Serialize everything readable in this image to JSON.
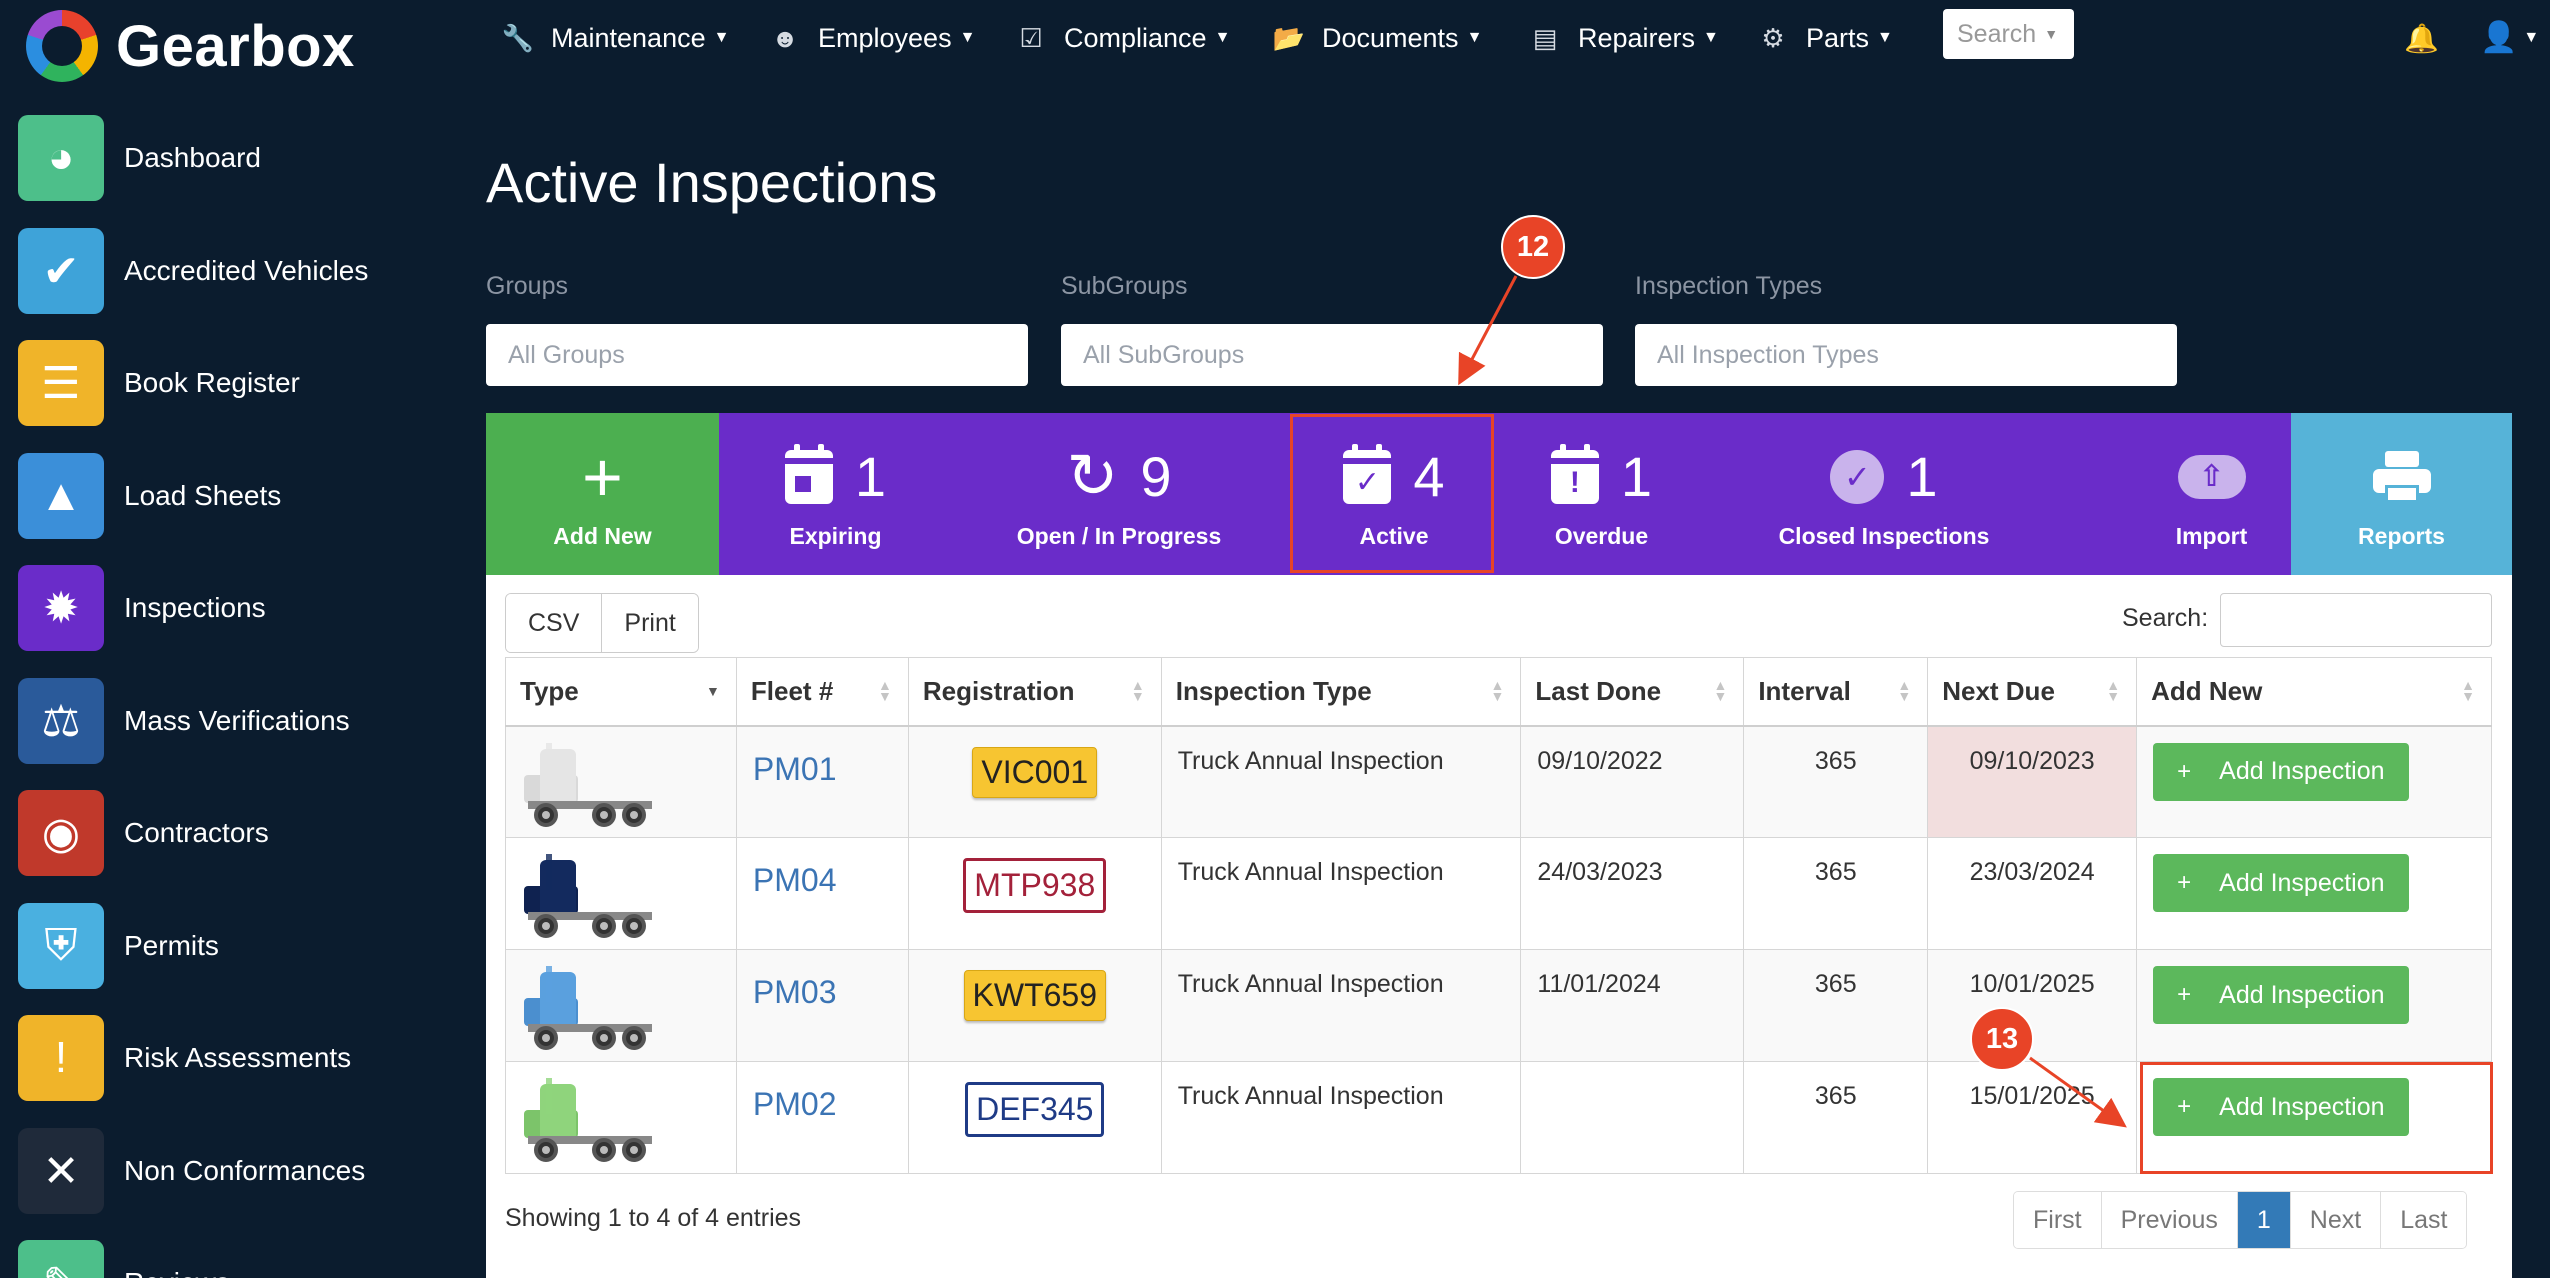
{
  "app": {
    "name": "Gearbox"
  },
  "nav": {
    "items": [
      {
        "label": "Maintenance",
        "icon": "wrench-icon"
      },
      {
        "label": "Employees",
        "icon": "user-circle-icon"
      },
      {
        "label": "Compliance",
        "icon": "calendar-check-icon"
      },
      {
        "label": "Documents",
        "icon": "folder-open-icon"
      },
      {
        "label": "Repairers",
        "icon": "id-card-icon"
      },
      {
        "label": "Parts",
        "icon": "gear-icon"
      }
    ],
    "search_placeholder": "Search"
  },
  "sidebar": {
    "items": [
      {
        "label": "Dashboard",
        "icon": "gauge-icon",
        "color": "#4dbf8a"
      },
      {
        "label": "Accredited Vehicles",
        "icon": "checkmark-icon",
        "color": "#3ea3d9"
      },
      {
        "label": "Book Register",
        "icon": "books-icon",
        "color": "#f0b429"
      },
      {
        "label": "Load Sheets",
        "icon": "bag-icon",
        "color": "#3b8fd9"
      },
      {
        "label": "Inspections",
        "icon": "badge-icon",
        "color": "#6a2cc9"
      },
      {
        "label": "Mass Verifications",
        "icon": "scales-icon",
        "color": "#2a5a9a"
      },
      {
        "label": "Contractors",
        "icon": "hardhat-icon",
        "color": "#c0392b"
      },
      {
        "label": "Permits",
        "icon": "shield-icon",
        "color": "#4ab0e0"
      },
      {
        "label": "Risk Assessments",
        "icon": "warning-file-icon",
        "color": "#f0b429"
      },
      {
        "label": "Non Conformances",
        "icon": "x-icon",
        "color": "#1f2a3a"
      },
      {
        "label": "Reviews",
        "icon": "clipboard-icon",
        "color": "#4dbf8a"
      }
    ]
  },
  "page": {
    "title": "Active Inspections",
    "filters": [
      {
        "label": "Groups",
        "value": "All Groups"
      },
      {
        "label": "SubGroups",
        "value": "All SubGroups"
      },
      {
        "label": "Inspection Types",
        "value": "All Inspection Types"
      }
    ]
  },
  "action_bar": {
    "tiles": [
      {
        "label": "Add New",
        "count": "",
        "icon": "plus-icon",
        "color": "#4caf50"
      },
      {
        "label": "Expiring",
        "count": "1",
        "icon": "calendar-icon",
        "color": "#6a2cc9"
      },
      {
        "label": "Open / In Progress",
        "count": "9",
        "icon": "refresh-icon",
        "color": "#6a2cc9"
      },
      {
        "label": "Active",
        "count": "4",
        "icon": "calendar-check-icon",
        "color": "#6a2cc9"
      },
      {
        "label": "Overdue",
        "count": "1",
        "icon": "calendar-alert-icon",
        "color": "#6a2cc9"
      },
      {
        "label": "Closed Inspections",
        "count": "1",
        "icon": "check-circle-icon",
        "color": "#6a2cc9"
      },
      {
        "label": "Import",
        "count": "",
        "icon": "cloud-upload-icon",
        "color": "#6a2cc9"
      },
      {
        "label": "Reports",
        "count": "",
        "icon": "printer-icon",
        "color": "#56b3d8"
      }
    ]
  },
  "table": {
    "export_buttons": [
      "CSV",
      "Print"
    ],
    "search_label": "Search:",
    "columns": [
      "Type",
      "Fleet #",
      "Registration",
      "Inspection Type",
      "Last Done",
      "Interval",
      "Next Due",
      "Add New"
    ],
    "rows": [
      {
        "truck_color": "#e5e5e5",
        "fleet": "PM01",
        "registration": "VIC001",
        "plate_style": "yellow",
        "inspection_type": "Truck Annual Inspection",
        "last_done": "09/10/2022",
        "interval": "365",
        "next_due": "09/10/2023",
        "due_highlight": true,
        "action": "Add Inspection"
      },
      {
        "truck_color": "#132a5e",
        "fleet": "PM04",
        "registration": "MTP938",
        "plate_style": "red",
        "inspection_type": "Truck Annual Inspection",
        "last_done": "24/03/2023",
        "interval": "365",
        "next_due": "23/03/2024",
        "due_highlight": false,
        "action": "Add Inspection"
      },
      {
        "truck_color": "#5aa0de",
        "fleet": "PM03",
        "registration": "KWT659",
        "plate_style": "yellow",
        "inspection_type": "Truck Annual Inspection",
        "last_done": "11/01/2024",
        "interval": "365",
        "next_due": "10/01/2025",
        "due_highlight": false,
        "action": "Add Inspection"
      },
      {
        "truck_color": "#8fd47c",
        "fleet": "PM02",
        "registration": "DEF345",
        "plate_style": "blue",
        "inspection_type": "Truck Annual Inspection",
        "last_done": "",
        "interval": "365",
        "next_due": "15/01/2025",
        "due_highlight": false,
        "action": "Add Inspection"
      }
    ],
    "info": "Showing 1 to 4 of 4 entries",
    "pagination": [
      "First",
      "Previous",
      "1",
      "Next",
      "Last"
    ]
  },
  "annotations": [
    {
      "number": "12"
    },
    {
      "number": "13"
    }
  ]
}
